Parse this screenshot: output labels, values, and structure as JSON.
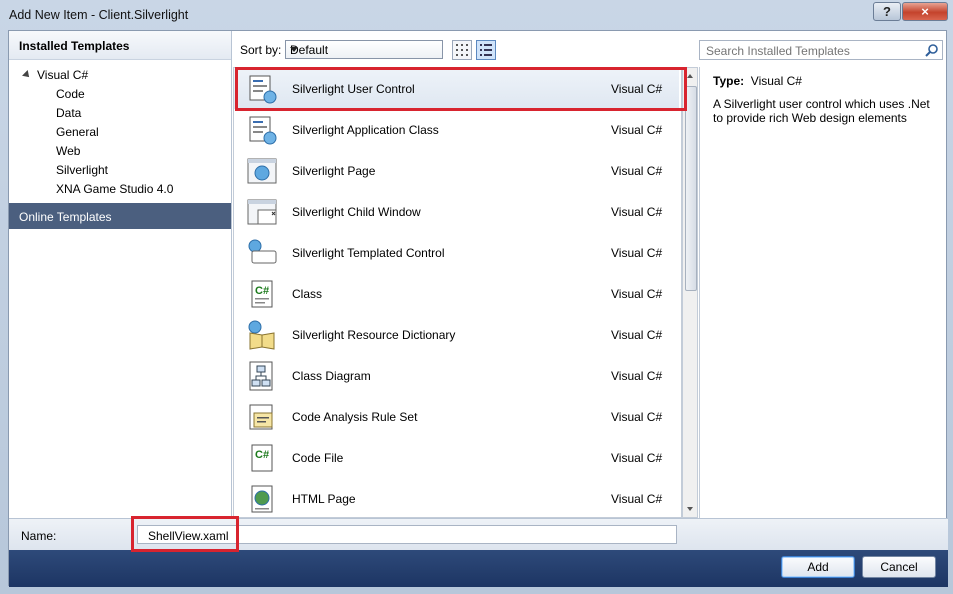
{
  "window": {
    "title": "Add New Item - Client.Silverlight",
    "help": "?",
    "close": "×"
  },
  "left_panel": {
    "header": "Installed Templates",
    "root": "Visual C#",
    "children": [
      "Code",
      "Data",
      "General",
      "Web",
      "Silverlight",
      "XNA Game Studio 4.0"
    ],
    "online": "Online Templates"
  },
  "toolbar": {
    "sort_label": "Sort by:",
    "sort_value": "Default",
    "search_placeholder": "Search Installed Templates"
  },
  "templates": [
    {
      "name": "Silverlight User Control",
      "lang": "Visual C#"
    },
    {
      "name": "Silverlight Application Class",
      "lang": "Visual C#"
    },
    {
      "name": "Silverlight Page",
      "lang": "Visual C#"
    },
    {
      "name": "Silverlight Child Window",
      "lang": "Visual C#"
    },
    {
      "name": "Silverlight Templated Control",
      "lang": "Visual C#"
    },
    {
      "name": "Class",
      "lang": "Visual C#"
    },
    {
      "name": "Silverlight Resource Dictionary",
      "lang": "Visual C#"
    },
    {
      "name": "Class Diagram",
      "lang": "Visual C#"
    },
    {
      "name": "Code Analysis Rule Set",
      "lang": "Visual C#"
    },
    {
      "name": "Code File",
      "lang": "Visual C#"
    },
    {
      "name": "HTML Page",
      "lang": "Visual C#"
    }
  ],
  "detail": {
    "type_label": "Type:",
    "type_value": "Visual C#",
    "description": "A Silverlight user control which uses .Net to provide rich Web design elements"
  },
  "name_field": {
    "label": "Name:",
    "value": "ShellView.xaml"
  },
  "buttons": {
    "add": "Add",
    "cancel": "Cancel"
  },
  "colors": {
    "highlight": "#d8242f",
    "footer": "#1d3563",
    "selected_category": "#4b5f7f"
  }
}
